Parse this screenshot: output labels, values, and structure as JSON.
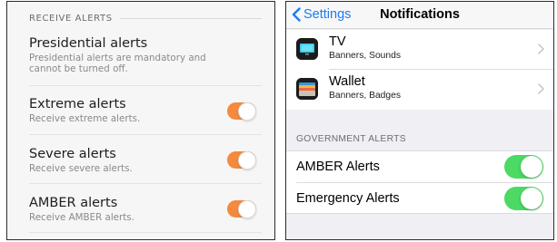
{
  "left_panel": {
    "section_header": "RECEIVE ALERTS",
    "items": [
      {
        "title": "Presidential alerts",
        "subtitle": "Presidential alerts are mandatory and cannot be turned off.",
        "has_toggle": false
      },
      {
        "title": "Extreme alerts",
        "subtitle": "Receive extreme alerts.",
        "has_toggle": true,
        "toggle_on": true
      },
      {
        "title": "Severe alerts",
        "subtitle": "Receive severe alerts.",
        "has_toggle": true,
        "toggle_on": true
      },
      {
        "title": "AMBER alerts",
        "subtitle": "Receive AMBER alerts.",
        "has_toggle": true,
        "toggle_on": true
      }
    ],
    "toggle_color": "#f5893d"
  },
  "right_panel": {
    "nav": {
      "back_label": "Settings",
      "title": "Notifications",
      "back_icon": "chevron-left-icon"
    },
    "apps": [
      {
        "name": "TV",
        "subtitle": "Banners, Sounds",
        "icon": "tv-app-icon"
      },
      {
        "name": "Wallet",
        "subtitle": "Banners, Badges",
        "icon": "wallet-app-icon"
      }
    ],
    "government_section_header": "GOVERNMENT ALERTS",
    "government_alerts": [
      {
        "label": "AMBER Alerts",
        "toggle_on": true
      },
      {
        "label": "Emergency Alerts",
        "toggle_on": true
      }
    ],
    "accent_color": "#1a7cf5",
    "toggle_color": "#4cd964"
  }
}
